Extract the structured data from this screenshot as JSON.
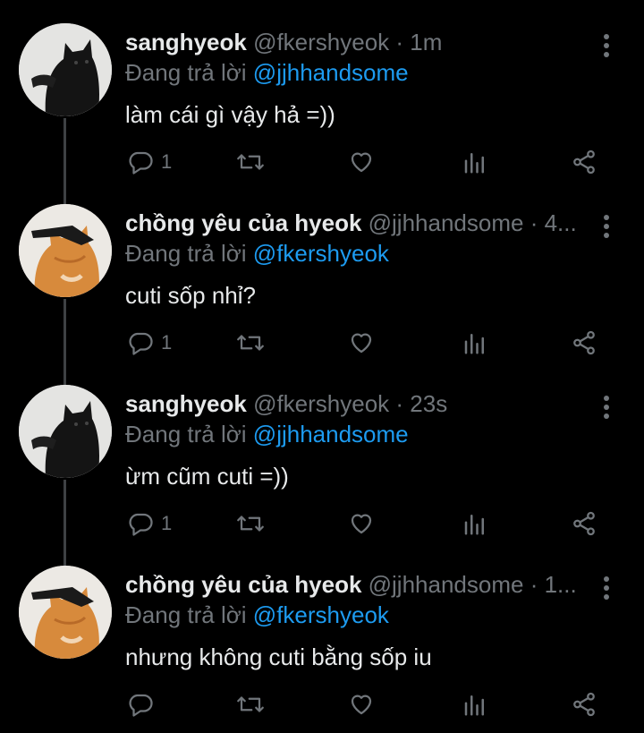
{
  "reply_prefix": "Đang trả lời",
  "tweets": [
    {
      "name": "sanghyeok",
      "meta": "@fkershyeok · 1m",
      "mention": "@jjhhandsome",
      "text": "làm cái gì vậy hả =))",
      "reply_count": "1"
    },
    {
      "name": "chồng yêu của hyeok",
      "meta": "@jjhhandsome · 4...",
      "mention": "@fkershyeok",
      "text": "cuti sốp nhỉ?",
      "reply_count": "1"
    },
    {
      "name": "sanghyeok",
      "meta": "@fkershyeok · 23s",
      "mention": "@jjhhandsome",
      "text": "ừm cũm cuti =))",
      "reply_count": "1"
    },
    {
      "name": "chồng yêu của hyeok",
      "meta": "@jjhhandsome · 1...",
      "mention": "@fkershyeok",
      "text": "nhưng không cuti bằng sốp iu",
      "reply_count": ""
    }
  ]
}
